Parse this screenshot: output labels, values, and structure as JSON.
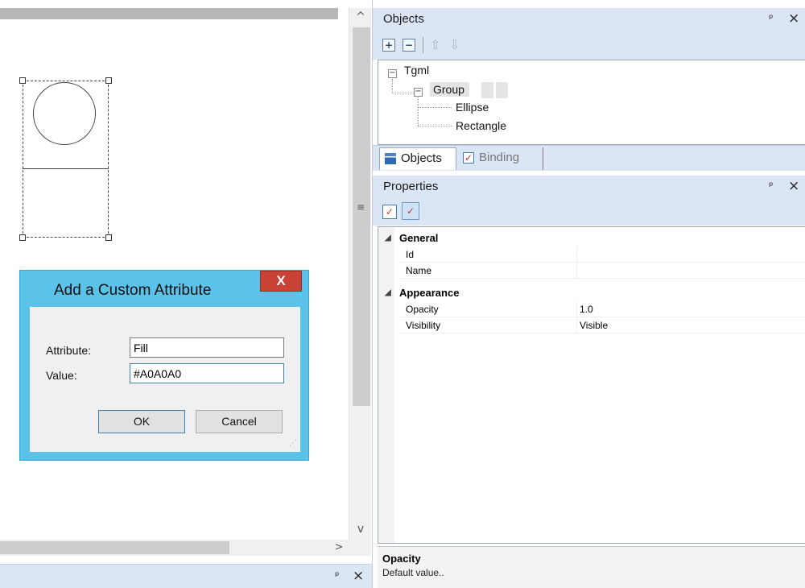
{
  "canvas": {
    "scroll": {
      "up_glyph": "^",
      "down_glyph": "v",
      "right_glyph": ">",
      "grip_glyph": "≡"
    }
  },
  "bottom_pane": {
    "pin_glyph": "ᵖ",
    "close_glyph": "×"
  },
  "dialog": {
    "title": "Add a Custom Attribute",
    "close_glyph": "X",
    "attribute_label": "Attribute:",
    "attribute_value": "Fill",
    "value_label": "Value:",
    "value_value": "#A0A0A0",
    "ok_label": "OK",
    "cancel_label": "Cancel"
  },
  "objects_panel": {
    "title": "Objects",
    "pin_glyph": "ᵖ",
    "close_glyph": "×",
    "toolbar": {
      "add_glyph": "+",
      "remove_glyph": "−",
      "up_glyph": "⇧",
      "down_glyph": "⇩"
    },
    "tree": {
      "root": "Tgml",
      "group": "Group",
      "children": [
        "Ellipse",
        "Rectangle"
      ]
    },
    "tabs": [
      {
        "label": "Objects",
        "icon": "objects-tab-icon",
        "active": true
      },
      {
        "label": "Binding",
        "icon": "binding-tab-icon",
        "active": false
      }
    ]
  },
  "properties_panel": {
    "title": "Properties",
    "pin_glyph": "ᵖ",
    "close_glyph": "×",
    "categories": [
      {
        "name": "General",
        "rows": [
          {
            "name": "Id",
            "value": ""
          },
          {
            "name": "Name",
            "value": ""
          }
        ]
      },
      {
        "name": "Appearance",
        "rows": [
          {
            "name": "Opacity",
            "value": "1.0"
          },
          {
            "name": "Visibility",
            "value": "Visible"
          }
        ]
      }
    ],
    "description": {
      "title": "Opacity",
      "text": "Default value.."
    }
  },
  "colors": {
    "panel_header": "#dbe6f4",
    "dialog_frame": "#5bc3e9",
    "dialog_close": "#c94235"
  }
}
